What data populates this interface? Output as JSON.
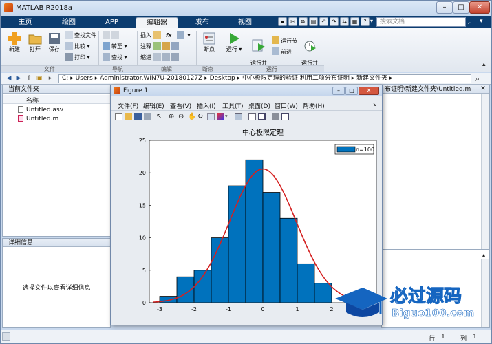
{
  "app": {
    "title": "MATLAB R2018a"
  },
  "tabs": [
    "主页",
    "绘图",
    "APP",
    "编辑器",
    "发布",
    "视图"
  ],
  "active_tab": "编辑器",
  "search": {
    "placeholder": "搜索文档"
  },
  "ribbon": {
    "new": "新建",
    "open": "打开",
    "save": "保存",
    "find_files": "查找文件",
    "compare": "比较",
    "print": "打印",
    "goto": "转至",
    "find": "查找",
    "insert": "插入",
    "comment": "注释",
    "indent": "缩进",
    "fx": "fx",
    "breakpoint": "断点",
    "run": "运行",
    "run_advance": "运行并\n前进",
    "run_section": "运行节",
    "advance": "前进",
    "run_time": "运行并\n计时",
    "groups": [
      "文件",
      "导航",
      "编辑",
      "断点",
      "运行"
    ]
  },
  "address": {
    "segments": [
      "C:",
      "Users",
      "Administrator.WIN7U-20180127Z",
      "Desktop",
      "中心极限定理的验证 利用二项分布证明",
      "新建文件夹"
    ],
    "sep": "▸"
  },
  "left_panel": {
    "title": "当前文件夹",
    "column": "名称",
    "files": [
      "Untitled.asv",
      "Untitled.m"
    ],
    "details_title": "详细信息",
    "details_text": "选择文件以查看详细信息"
  },
  "editor_tab": {
    "path": "布证明\\新建文件夹\\Untitled.m"
  },
  "figure": {
    "title": "Figure 1",
    "menus": [
      "文件(F)",
      "编辑(E)",
      "查看(V)",
      "插入(I)",
      "工具(T)",
      "桌面(D)",
      "窗口(W)",
      "帮助(H)"
    ]
  },
  "chart_data": {
    "type": "bar",
    "title": "中心极限定理",
    "legend": "n=100",
    "legend_position": "top-right",
    "bin_edges": [
      -3,
      -2.5,
      -2,
      -1.5,
      -1,
      -0.5,
      0,
      0.5,
      1,
      1.5,
      2,
      2.5
    ],
    "values": [
      1,
      4,
      5,
      10,
      18,
      22,
      17,
      13,
      6,
      3,
      0
    ],
    "xlim": [
      -3.3,
      3.3
    ],
    "ylim": [
      0,
      25
    ],
    "xticks": [
      -3,
      -2,
      -1,
      0,
      1,
      2,
      3
    ],
    "yticks": [
      0,
      5,
      10,
      15,
      20,
      25
    ],
    "bar_color": "#0072bd",
    "curve_color": "#d42020",
    "curve": {
      "mean": 0,
      "std": 0.97,
      "peak": 20.6
    }
  },
  "status": {
    "row_label": "行",
    "row": "1",
    "col_label": "列",
    "col": "1"
  },
  "watermark": {
    "text": "必过源码",
    "url": "Biguo100.com"
  }
}
